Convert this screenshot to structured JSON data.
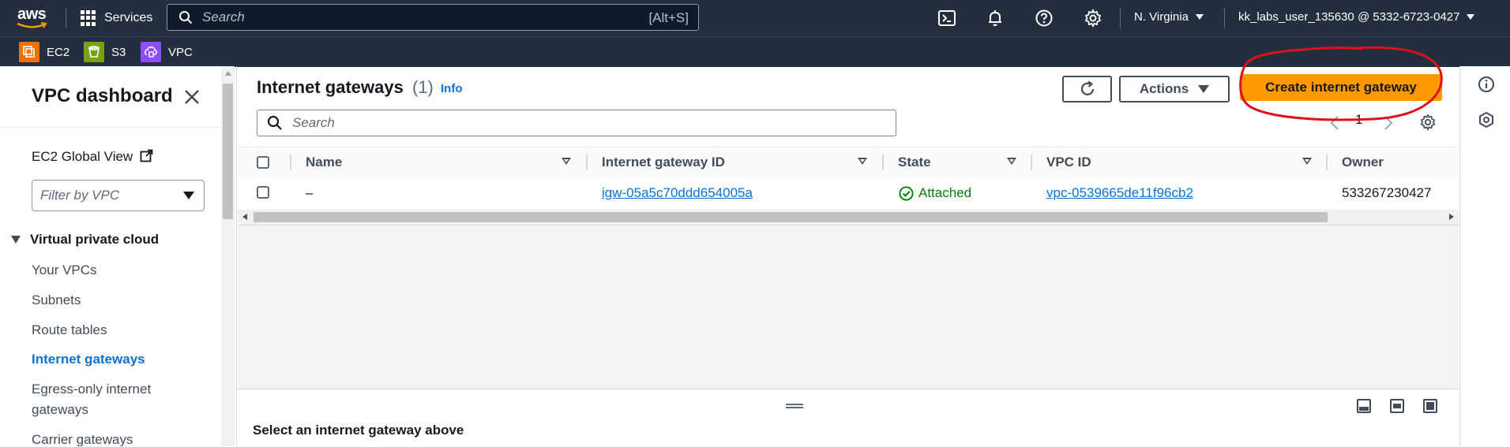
{
  "topnav": {
    "logo_text": "aws",
    "services_label": "Services",
    "search_placeholder": "Search",
    "search_shortcut": "[Alt+S]",
    "region": "N. Virginia",
    "user": "kk_labs_user_135630 @ 5332-6723-0427"
  },
  "favorites": [
    {
      "label": "EC2",
      "icon": "ec2-icon",
      "color": "#ed7100"
    },
    {
      "label": "S3",
      "icon": "s3-icon",
      "color": "#7aa116"
    },
    {
      "label": "VPC",
      "icon": "vpc-icon",
      "color": "#8c4fff"
    }
  ],
  "sidebar": {
    "title": "VPC dashboard",
    "global_view": "EC2 Global View",
    "filter_placeholder": "Filter by VPC",
    "section": "Virtual private cloud",
    "items": [
      "Your VPCs",
      "Subnets",
      "Route tables",
      "Internet gateways",
      "Egress-only internet gateways",
      "Carrier gateways"
    ],
    "active_item": "Internet gateways"
  },
  "main": {
    "title": "Internet gateways",
    "count": "(1)",
    "info_label": "Info",
    "actions_label": "Actions",
    "create_label": "Create internet gateway",
    "search_placeholder": "Search",
    "page_number": "1",
    "columns": [
      "Name",
      "Internet gateway ID",
      "State",
      "VPC ID",
      "Owner"
    ],
    "rows": [
      {
        "name": "–",
        "id": "igw-05a5c70ddd654005a",
        "state": "Attached",
        "vpc_id": "vpc-0539665de11f96cb2",
        "owner": "533267230427"
      }
    ],
    "split_panel_title": "Select an internet gateway above"
  },
  "colors": {
    "nav_bg": "#232f3e",
    "primary": "#ff9900",
    "link": "#0972d3",
    "success": "#037f0c",
    "annotation": "#e0101a"
  }
}
